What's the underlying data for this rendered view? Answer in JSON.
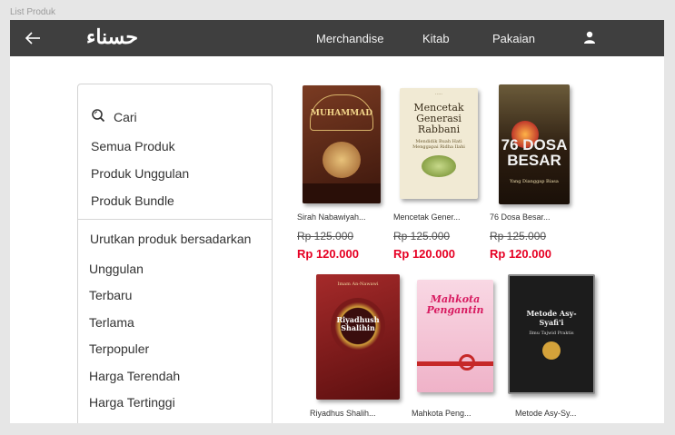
{
  "frame_label": "List Produk",
  "header": {
    "logo": "حسناء",
    "nav": [
      "Merchandise",
      "Kitab",
      "Pakaian"
    ]
  },
  "sidebar": {
    "search_label": "Cari",
    "filters": [
      "Semua Produk",
      "Produk Unggulan",
      "Produk Bundle"
    ],
    "sort_heading": "Urutkan produk bersadarkan",
    "sort_options": [
      "Unggulan",
      "Terbaru",
      "Terlama",
      "Terpopuler",
      "Harga Terendah",
      "Harga Tertinggi"
    ]
  },
  "products": [
    {
      "name": "Sirah Nabawiyah...",
      "old_price": "Rp 125.000",
      "price": "Rp 120.000",
      "cover_title": "MUHAMMAD",
      "cover_color": "#5a2a1a"
    },
    {
      "name": "Mencetak Gener...",
      "old_price": "Rp 125.000",
      "price": "Rp 120.000",
      "cover_title": "Mencetak Generasi Rabbani",
      "cover_subtitle": "Mendidik Buah Hati Menggapai Ridha Ilahi",
      "cover_color": "#f1ead4"
    },
    {
      "name": "76 Dosa Besar...",
      "old_price": "Rp 125.000",
      "price": "Rp 120.000",
      "cover_title": "76 DOSA BESAR",
      "cover_subtitle": "Yang Dianggap Biasa",
      "cover_color": "#3b2a1a"
    },
    {
      "name": "Riyadhus Shalih...",
      "cover_title": "Riyadhush Shalihin",
      "cover_author": "Imam An-Nawawi",
      "cover_color": "#8a1f1f"
    },
    {
      "name": "Mahkota Peng...",
      "cover_title": "Mahkota Pengantin",
      "cover_color": "#f5c6d6"
    },
    {
      "name": "Metode Asy-Sy...",
      "cover_title": "Metode Asy-Syafi'i",
      "cover_subtitle": "Ilmu Tajwid Praktis",
      "cover_color": "#1c1c1c"
    }
  ],
  "colors": {
    "header_bg": "#3f3f3f",
    "price_accent": "#e60023"
  }
}
